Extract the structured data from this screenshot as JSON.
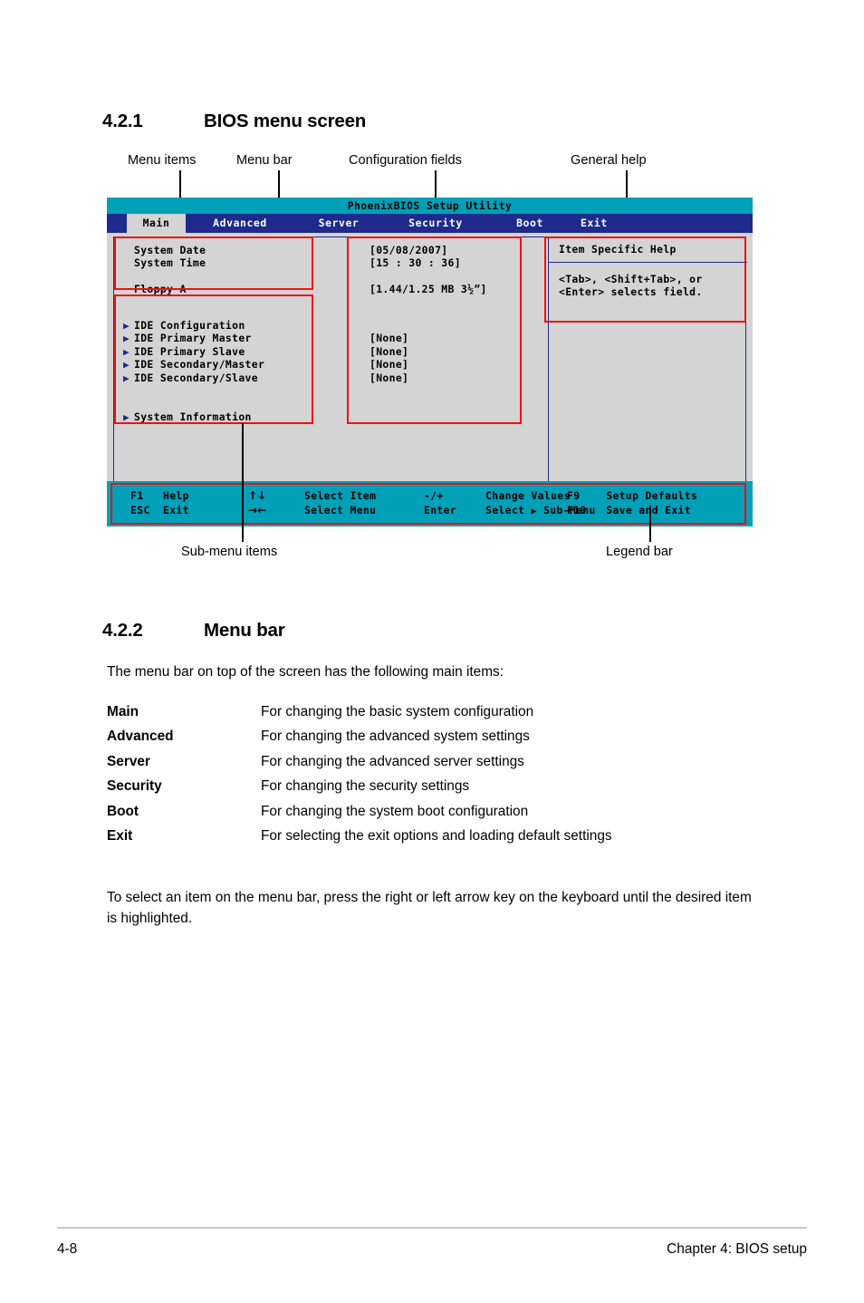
{
  "sections": {
    "s421": {
      "number": "4.2.1",
      "title": "BIOS menu screen"
    },
    "s422": {
      "number": "4.2.2",
      "title": "Menu bar"
    }
  },
  "paragraphs": {
    "intro": "The menu bar on top of the screen has the following main items:",
    "outro": "To select an item on the menu bar, press the right or left arrow key on the keyboard until the desired item is highlighted."
  },
  "menu_definitions": [
    {
      "term": "Main",
      "desc": "For changing the basic system configuration"
    },
    {
      "term": "Advanced",
      "desc": "For changing the advanced system settings"
    },
    {
      "term": "Server",
      "desc": "For changing the advanced server settings"
    },
    {
      "term": "Security",
      "desc": "For changing the security settings"
    },
    {
      "term": "Boot",
      "desc": "For changing the system boot configuration"
    },
    {
      "term": "Exit",
      "desc": "For selecting the exit options and loading default settings"
    }
  ],
  "callouts": {
    "menu_items": "Menu items",
    "menu_bar": "Menu bar",
    "configuration_fields": "Configuration fields",
    "general_help": "General help",
    "sub_menu_items": "Sub-menu items",
    "legend_bar": "Legend bar"
  },
  "bios": {
    "title": "PhoenixBIOS Setup Utility",
    "menu_tabs": [
      {
        "label": "Main",
        "active": true
      },
      {
        "label": "Advanced",
        "active": false
      },
      {
        "label": "Server",
        "active": false
      },
      {
        "label": "Security",
        "active": false
      },
      {
        "label": "Boot",
        "active": false
      },
      {
        "label": "Exit",
        "active": false
      }
    ],
    "items": [
      {
        "label": "System Date",
        "value": "[05/08/2007]",
        "submenu": false
      },
      {
        "label": "System Time",
        "value": "[15 : 30 : 36]",
        "submenu": false
      },
      {
        "label": "Floppy A",
        "value": "[1.44/1.25 MB 3½”]",
        "submenu": false
      },
      {
        "label": "IDE Configuration",
        "value": "",
        "submenu": true
      },
      {
        "label": "IDE Primary Master",
        "value": "[None]",
        "submenu": true
      },
      {
        "label": "IDE Primary Slave",
        "value": "[None]",
        "submenu": true
      },
      {
        "label": "IDE Secondary/Master",
        "value": "[None]",
        "submenu": true
      },
      {
        "label": "IDE Secondary/Slave",
        "value": "[None]",
        "submenu": true
      },
      {
        "label": "System Information",
        "value": "",
        "submenu": true
      }
    ],
    "help": {
      "title": "Item Specific Help",
      "text": "<Tab>, <Shift+Tab>, or\n<Enter> selects field."
    },
    "legend": {
      "row1": {
        "key1": "F1",
        "act1": "Help",
        "nav": "↑↓",
        "act2": "Select Item",
        "key3": "-/+",
        "act3": "Change Values",
        "key4": "F9",
        "act4": "Setup Defaults"
      },
      "row2": {
        "key1": "ESC",
        "act1": "Exit",
        "nav": "→←",
        "act2": "Select Menu",
        "key3": "Enter",
        "act3a": "Select",
        "act3b": "Sub-Menu",
        "key4": "F10",
        "act4": "Save and Exit"
      }
    },
    "colors": {
      "titlebar": "#00a0b8",
      "menubar": "#1e2a8c",
      "screen_bg": "#d4d4d4",
      "highlight": "#ee1111",
      "legend_bg": "#00a0b8"
    }
  },
  "footer": {
    "page": "4-8",
    "chapter": "Chapter 4: BIOS setup"
  }
}
